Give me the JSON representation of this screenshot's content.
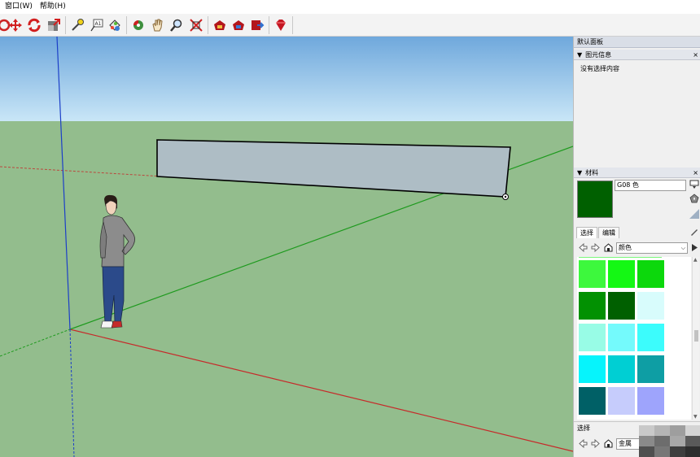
{
  "menu": [
    "窗口(W)",
    "帮助(H)"
  ],
  "toolbar": {
    "icons": [
      "orbit-icon",
      "move-icon",
      "rotate-icon",
      "scale-icon",
      "tape-measure-icon",
      "text-tool-icon",
      "paint-bucket-icon",
      "walk-icon",
      "pan-icon",
      "zoom-icon",
      "zoom-extents-icon",
      "warehouse-icon",
      "extension-warehouse-icon",
      "share-model-icon",
      "ruby-icon"
    ]
  },
  "tray": {
    "title": "默认面板",
    "entity_info": {
      "header": "图元信息",
      "message": "没有选择内容"
    },
    "materials": {
      "header": "材料",
      "current_name": "G08 色",
      "current_color": "#006000",
      "tabs": [
        "选择",
        "编辑"
      ],
      "library": "颜色",
      "swatches": [
        "#3df83d",
        "#14f814",
        "#0cd80c",
        "#029102",
        "#006000",
        "#d8fcfc",
        "#98fce6",
        "#74fafc",
        "#3cfcfc",
        "#06f4fc",
        "#00cfd3",
        "#0e9ea4",
        "#006066",
        "#c6ccfc",
        "#9ea4fc"
      ],
      "secondary_label": "选择",
      "secondary_select": "金属"
    }
  },
  "colors": {
    "sky_top": "#6fa8dc",
    "sky_bottom": "#c9e6f7",
    "ground": "#93bd8d",
    "axis_red": "#c62a2a",
    "axis_green": "#1e9a1e",
    "axis_blue": "#1c3fc8",
    "wall": "#aebdc5"
  }
}
